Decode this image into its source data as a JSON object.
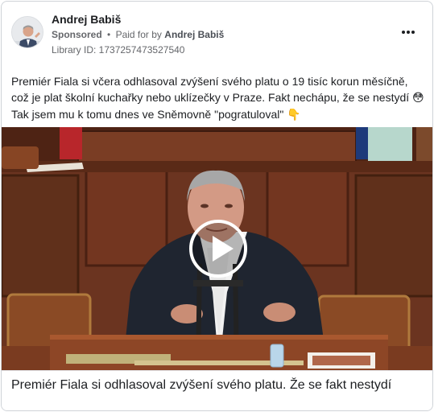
{
  "post": {
    "author": "Andrej Babiš",
    "sponsored_label": "Sponsored",
    "separator": "•",
    "paid_for_prefix": "Paid for by",
    "payer": "Andrej Babiš",
    "library_id": "Library ID: 1737257473527540",
    "more_icon": "more-horizontal-icon",
    "text_part1": "Premiér Fiala si včera odhlasoval zvýšení svého platu o 19 tisíc korun měsíčně, což je plat školní kuchařky nebo uklízečky v Praze. Fakt nechápu, že se nestydí ",
    "emoji_flushed": "😳",
    "text_part2": " Tak jsem mu k tomu dnes ve Sněmovně \"pogratuloval\" ",
    "emoji_point_down": "👇"
  },
  "video": {
    "play_icon": "play-icon",
    "caption": "Premiér Fiala si odhlasoval zvýšení svého platu. Že se fakt nestydí"
  },
  "colors": {
    "text": "#1c1e21",
    "secondary_text": "#65676b",
    "border": "#cfd3d8",
    "wood_panel": "#6b3420",
    "jacket": "#1f2530"
  }
}
